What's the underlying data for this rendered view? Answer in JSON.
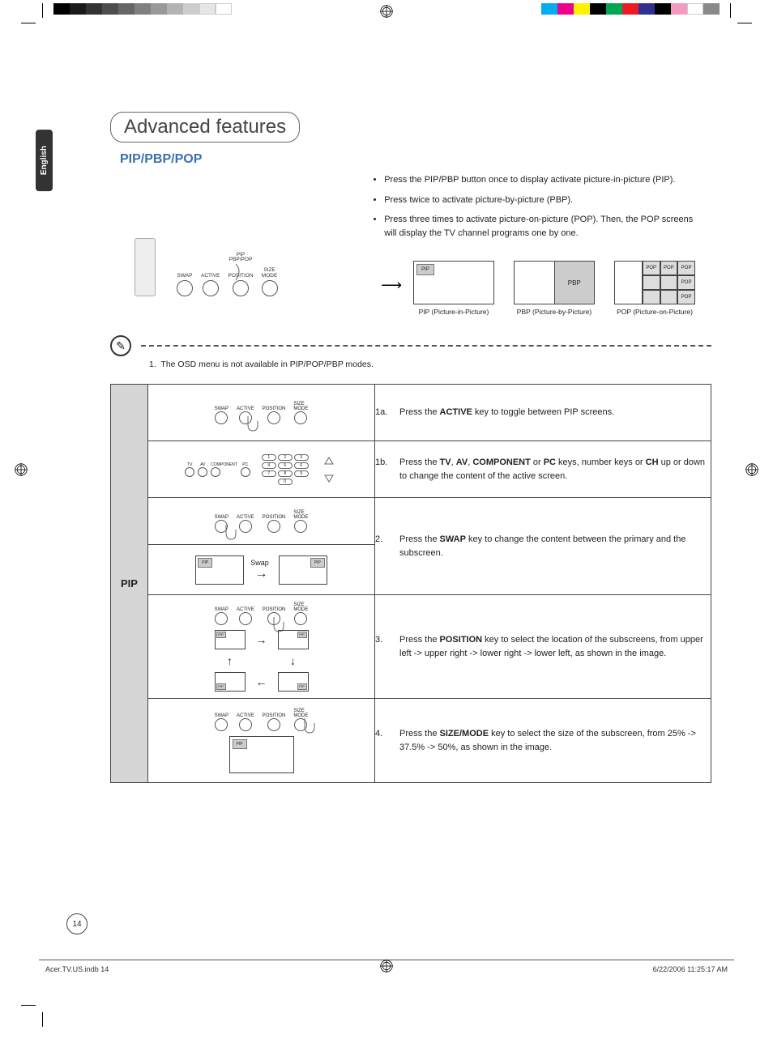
{
  "meta": {
    "language_tab": "English",
    "page_number": "14",
    "footer_file": "Acer.TV.US.indb   14",
    "footer_datetime": "6/22/2006   11:25:17 AM"
  },
  "headings": {
    "section": "Advanced features",
    "subsection": "PIP/PBP/POP"
  },
  "intro_bullets": [
    "Press the PIP/PBP button once to display activate picture-in-picture (PIP).",
    "Press twice to activate picture-by-picture (PBP).",
    "Press  three times to activate picture-on-picture (POP). Then, the POP screens will display the TV channel programs one by one."
  ],
  "remote_buttons": {
    "top_label": "PIP\nPBP/POP",
    "labels": [
      "SWAP",
      "ACTIVE",
      "POSITION",
      "SIZE\nMODE"
    ]
  },
  "thumbs": {
    "pip_label": "PIP",
    "pip_caption": "PIP (Picture-in-Picture)",
    "pbp_label": "PBP",
    "pbp_caption": "PBP (Picture-by-Picture)",
    "pop_label": "POP",
    "pop_caption": "POP (Picture-on-Picture)"
  },
  "note": {
    "num": "1.",
    "text": "The OSD menu is not available in PIP/POP/PBP modes."
  },
  "table": {
    "row_head": "PIP",
    "steps": [
      {
        "prefix": "1a.",
        "html": "Press the <strong>ACTIVE</strong> key to toggle between PIP screens."
      },
      {
        "prefix": "1b.",
        "html": "Press the <strong>TV</strong>, <strong>AV</strong>, <strong>COMPONENT</strong> or <strong>PC</strong> keys, number keys or <strong>CH</strong> up or down to change the content of the active screen."
      },
      {
        "prefix": "2.",
        "html": "Press the <strong>SWAP</strong> key to change the content between the primary and the subscreen."
      },
      {
        "prefix": "3.",
        "html": "Press the <strong>POSITION</strong> key to select the location of the subscreens, from upper left -> upper right -> lower right -> lower left, as shown in the image."
      },
      {
        "prefix": "4.",
        "html": "Press the <strong>SIZE/MODE</strong> key to select the size of the subscreen, from 25% -> 37.5% -> 50%, as shown in the image."
      }
    ],
    "swap_label": "Swap",
    "source_labels": [
      "TV",
      "AV",
      "COMPONENT",
      "PC"
    ],
    "keypad": [
      "1",
      "2",
      "3",
      "4",
      "5",
      "6",
      "7",
      "8",
      "9",
      "",
      "0",
      ""
    ]
  }
}
